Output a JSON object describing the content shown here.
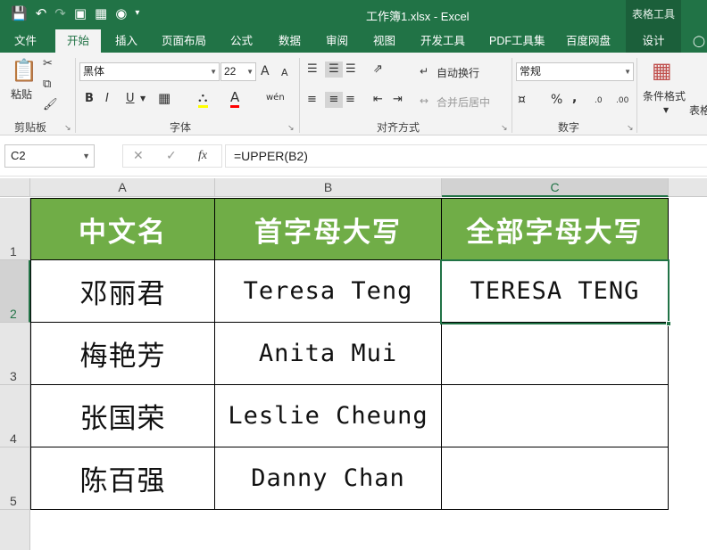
{
  "window": {
    "title": "工作簿1.xlsx - Excel",
    "context_tab_group": "表格工具"
  },
  "quick_access": {
    "icons": [
      "save-icon",
      "undo-icon",
      "redo-icon",
      "screenshot-icon",
      "insert-picture-icon",
      "camera-icon",
      "customize-icon"
    ]
  },
  "tabs": {
    "file": "文件",
    "home": "开始",
    "insert": "插入",
    "page_layout": "页面布局",
    "formulas": "公式",
    "data": "数据",
    "review": "审阅",
    "view": "视图",
    "developer": "开发工具",
    "pdf": "PDF工具集",
    "baidu": "百度网盘",
    "design": "设计"
  },
  "ribbon": {
    "clipboard": {
      "paste": "粘贴",
      "group": "剪贴板"
    },
    "font": {
      "name": "黑体",
      "size": "22",
      "bold": "B",
      "italic": "I",
      "underline": "U",
      "grow": "A",
      "shrink": "A",
      "font_color_label": "A",
      "phonetic": "wén",
      "group": "字体"
    },
    "alignment": {
      "wrap": "自动换行",
      "merge": "合并后居中",
      "group": "对齐方式"
    },
    "number": {
      "format": "常规",
      "group": "数字"
    },
    "styles": {
      "conditional": "条件格式",
      "table": "表格"
    }
  },
  "formula_bar": {
    "name_box": "C2",
    "cancel": "✕",
    "enter": "✓",
    "fx": "fx",
    "formula": "=UPPER(B2)"
  },
  "sheet": {
    "columns": [
      "A",
      "B",
      "C"
    ],
    "rows": [
      "1",
      "2",
      "3",
      "4",
      "5"
    ],
    "selected_cell": "C2",
    "header_color": "#70ad47",
    "accent_color": "#217346",
    "headers": [
      "中文名",
      "首字母大写",
      "全部字母大写"
    ],
    "data": [
      [
        "邓丽君",
        "Teresa Teng",
        "TERESA TENG"
      ],
      [
        "梅艳芳",
        "Anita Mui",
        ""
      ],
      [
        "张国荣",
        "Leslie Cheung",
        ""
      ],
      [
        "陈百强",
        "Danny Chan",
        ""
      ]
    ]
  }
}
